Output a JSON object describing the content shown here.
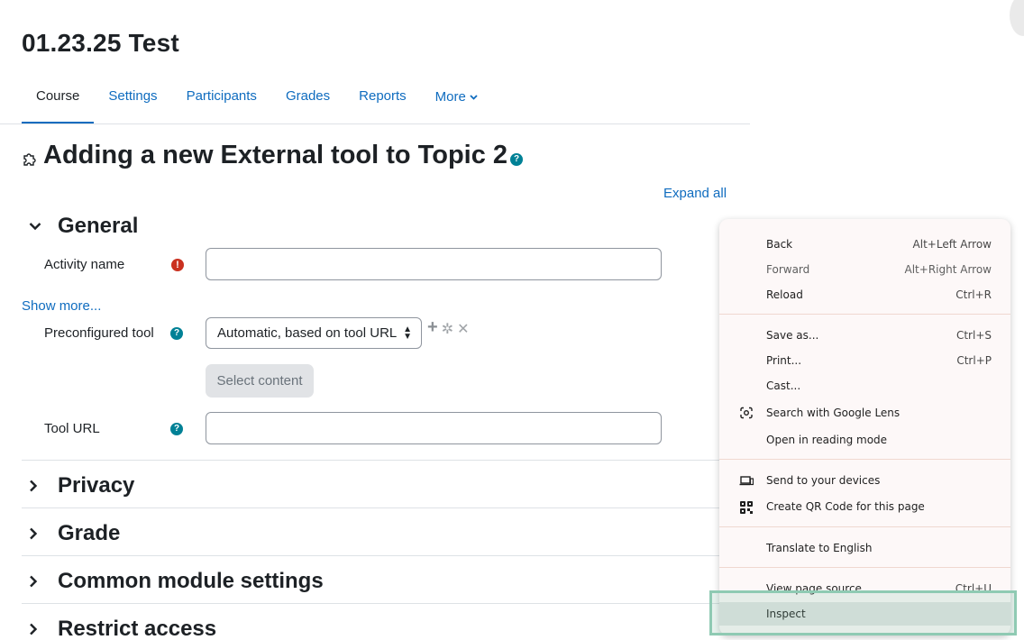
{
  "course_title": "01.23.25 Test",
  "nav": {
    "items": [
      {
        "label": "Course",
        "active": true
      },
      {
        "label": "Settings"
      },
      {
        "label": "Participants"
      },
      {
        "label": "Grades"
      },
      {
        "label": "Reports"
      },
      {
        "label": "More"
      }
    ]
  },
  "page": {
    "heading": "Adding a new External tool to Topic 2",
    "help_glyph": "?",
    "expand_all": "Expand all"
  },
  "general": {
    "title": "General",
    "activity_name_label": "Activity name",
    "required_glyph": "!",
    "show_more": "Show more...",
    "preconfigured_label": "Preconfigured tool",
    "preconfigured_value": "Automatic, based on tool URL",
    "select_content": "Select content",
    "tool_url_label": "Tool URL"
  },
  "sections": {
    "privacy": "Privacy",
    "grade": "Grade",
    "common": "Common module settings",
    "restrict": "Restrict access"
  },
  "context_menu": {
    "back": {
      "label": "Back",
      "shortcut": "Alt+Left Arrow"
    },
    "forward": {
      "label": "Forward",
      "shortcut": "Alt+Right Arrow"
    },
    "reload": {
      "label": "Reload",
      "shortcut": "Ctrl+R"
    },
    "save_as": {
      "label": "Save as...",
      "shortcut": "Ctrl+S"
    },
    "print": {
      "label": "Print...",
      "shortcut": "Ctrl+P"
    },
    "cast": {
      "label": "Cast..."
    },
    "lens": {
      "label": "Search with Google Lens"
    },
    "reading": {
      "label": "Open in reading mode"
    },
    "send": {
      "label": "Send to your devices"
    },
    "qr": {
      "label": "Create QR Code for this page"
    },
    "translate": {
      "label": "Translate to English"
    },
    "view_source": {
      "label": "View page source",
      "shortcut": "Ctrl+U"
    },
    "inspect": {
      "label": "Inspect"
    }
  },
  "colors": {
    "link": "#0f6cbf",
    "required": "#ca3120",
    "help": "#008196",
    "highlight": "#8fcab3"
  }
}
